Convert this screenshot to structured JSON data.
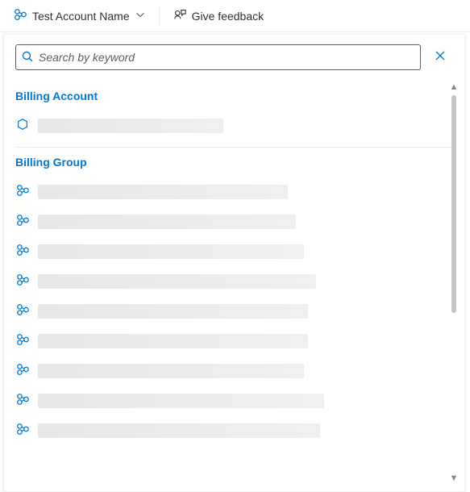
{
  "toolbar": {
    "account_name": "Test Account Name",
    "feedback_label": "Give feedback"
  },
  "search": {
    "placeholder": "Search by keyword"
  },
  "sections": {
    "billing_account": {
      "header": "Billing Account",
      "items": [
        {
          "redacted_width": 230
        }
      ]
    },
    "billing_group": {
      "header": "Billing Group",
      "items": [
        {
          "redacted_width": 310
        },
        {
          "redacted_width": 320
        },
        {
          "redacted_width": 330
        },
        {
          "redacted_width": 345
        },
        {
          "redacted_width": 335
        },
        {
          "redacted_width": 335
        },
        {
          "redacted_width": 330
        },
        {
          "redacted_width": 355
        },
        {
          "redacted_width": 350
        }
      ]
    }
  },
  "colors": {
    "accent": "#0078d4",
    "icon": "#0078d4",
    "text": "#323130",
    "muted": "#605e5c"
  },
  "icon_names": {
    "org": "org-icon",
    "feedback": "feedback-icon",
    "chevron_down": "chevron-down-icon",
    "search": "search-icon",
    "close": "close-icon",
    "hexagon": "hexagon-icon"
  }
}
